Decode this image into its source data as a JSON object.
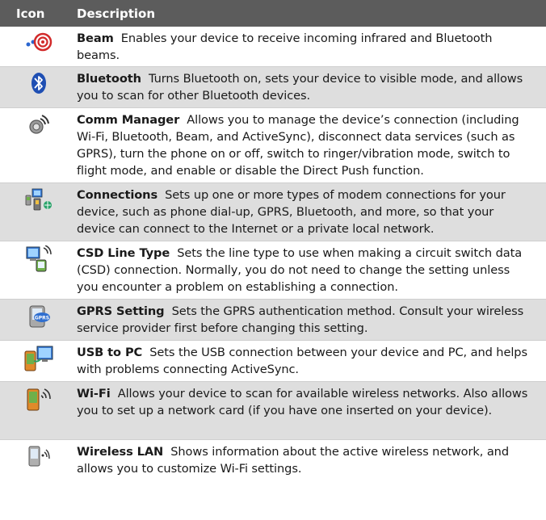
{
  "header": {
    "icon_col": "Icon",
    "desc_col": "Description"
  },
  "rows": [
    {
      "icon": "beam-icon",
      "name": "Beam",
      "text": "Enables your device to receive incoming infrared and Bluetooth beams."
    },
    {
      "icon": "bluetooth-icon",
      "name": "Bluetooth",
      "text": "Turns Bluetooth on, sets your device to visible mode, and allows you to scan for other Bluetooth devices."
    },
    {
      "icon": "comm-manager-icon",
      "name": "Comm Manager",
      "text": "Allows you to manage the device’s connection (including Wi-Fi, Bluetooth, Beam, and ActiveSync), disconnect data services (such as GPRS), turn the phone on or off, switch to ringer/vibration mode, switch to flight mode, and enable or disable the Direct Push function."
    },
    {
      "icon": "connections-icon",
      "name": "Connections",
      "text": "Sets up one or more types of modem connections for your device, such as phone dial-up, GPRS, Bluetooth, and more, so that your device can connect to the Internet or a private local network."
    },
    {
      "icon": "csd-line-type-icon",
      "name": "CSD Line Type",
      "text": "Sets the line type to use when making a circuit switch data (CSD) connection. Normally, you do not need to change the setting unless you encounter a problem on establishing a connection."
    },
    {
      "icon": "gprs-setting-icon",
      "name": "GPRS Setting",
      "text": "Sets the GPRS authentication method. Consult your wireless service provider first before changing this setting."
    },
    {
      "icon": "usb-to-pc-icon",
      "name": "USB to PC",
      "text": "Sets the USB connection between your device and PC, and helps with problems connecting ActiveSync."
    },
    {
      "icon": "wifi-icon",
      "name": "Wi-Fi",
      "text": "Allows your device to scan for available wireless networks. Also allows you to set up a network card (if you have one inserted on your device)."
    },
    {
      "icon": "wireless-lan-icon",
      "name": "Wireless LAN",
      "text": "Shows information about the active wireless network, and allows you to customize Wi-Fi settings."
    }
  ],
  "icon_labels": {
    "gprs": "GPRS"
  }
}
